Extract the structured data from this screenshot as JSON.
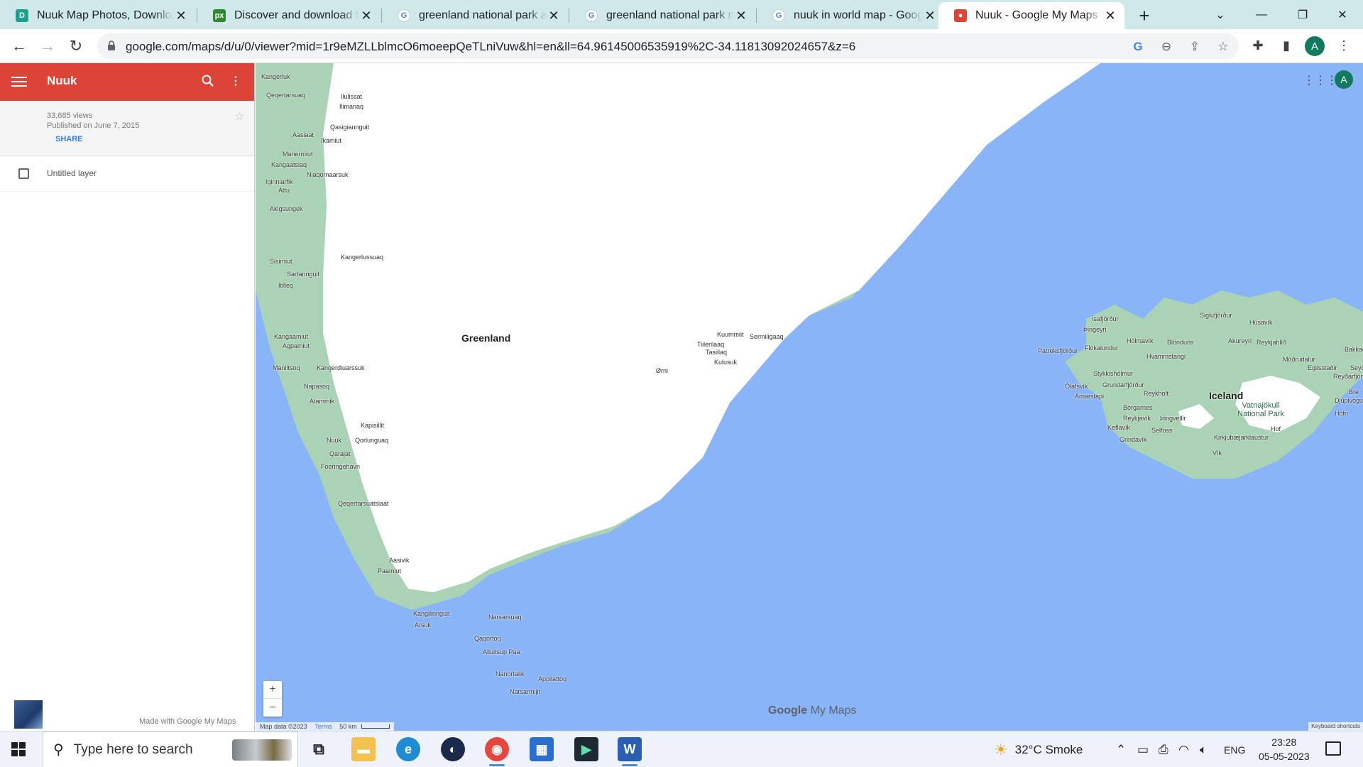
{
  "browser": {
    "tabs": [
      {
        "title": "Nuuk Map Photos, Download",
        "favicon": "D",
        "favicon_color": "#1ba28e",
        "active": false
      },
      {
        "title": "Discover and download free",
        "favicon": "PX",
        "favicon_color": "#2c8a2c",
        "active": false
      },
      {
        "title": "greenland national park and",
        "favicon": "G",
        "favicon_color": "#4285f4",
        "active": false
      },
      {
        "title": "greenland national park map",
        "favicon": "G",
        "favicon_color": "#4285f4",
        "active": false
      },
      {
        "title": "nuuk in world map - Google",
        "favicon": "G",
        "favicon_color": "#4285f4",
        "active": false
      },
      {
        "title": "Nuuk - Google My Maps",
        "favicon": "pin",
        "favicon_color": "#db4437",
        "active": true
      }
    ],
    "url": "google.com/maps/d/u/0/viewer?mid=1r9eMZLLblmcO6moeepQeTLniVuw&hl=en&ll=64.96145006535919%2C-34.11813092024657&z=6",
    "profile_initial": "A"
  },
  "sidebar": {
    "title": "Nuuk",
    "views": "33,685 views",
    "published": "Published on June 7, 2015",
    "share_label": "SHARE",
    "layer_label": "Untitled layer",
    "made_with": "Made with Google My Maps"
  },
  "map": {
    "labels": {
      "greenland": "Greenland",
      "iceland": "Iceland",
      "park": "Vatnajökull\nNational Park"
    },
    "greenland_towns": [
      "Kangerluk",
      "Qeqertarsuaq",
      "Ilulissat",
      "Ilimanaq",
      "Qasigiannguit",
      "Aasiaat",
      "Ikamiut",
      "Manermiut",
      "Kangaatsiaq",
      "Niaqornaarsuk",
      "Iginniarfik",
      "Attu",
      "Akigsungek",
      "Sisimiut",
      "Kangerlussuaq",
      "Sarfannguit",
      "Itilleq",
      "Kangaamiut",
      "Agpamiut",
      "Maniitsoq",
      "Kangerdluarssuk",
      "Napasoq",
      "Atammik",
      "Kapisillit",
      "Nuuk",
      "Qorlunguaq",
      "Qarajat",
      "Foeringehavn",
      "Qeqertarsuatsiaat",
      "Aasivik",
      "Paamiut",
      "Kangilinnguit",
      "Arsuk",
      "Narsarsuaq",
      "Qaqortoq",
      "Alluitsup Paa",
      "Nanortalik",
      "Narsarmijit",
      "Appilattoq",
      "Kuummiit",
      "Sermiligaaq",
      "Tiilerilaaq",
      "Tasiilaq",
      "Kulusuk",
      "Ørni"
    ],
    "iceland_towns": [
      "Ísafjörður",
      "Siglufjörður",
      "Húsavík",
      "Þingeyri",
      "Hólmavík",
      "Blönduós",
      "Akureyri",
      "Reykjahlíð",
      "Patreksfjörður",
      "Flókalundur",
      "Hvammstangi",
      "Möðrudalur",
      "Bakkag",
      "Egilsstaðir",
      "Seyð",
      "Reyðarfjörður",
      "Stykkishólmur",
      "Ólafsvík",
      "Grundarfjörður",
      "Arnarstapi",
      "Reykholt",
      "Borgarnes",
      "Reykjavík",
      "Þingvellir",
      "Keflavík",
      "Selfoss",
      "Grindavík",
      "Djúpivogur",
      "Höfn",
      "Hof",
      "Kirkjubæjarklaustur",
      "Vík",
      "Bre"
    ],
    "logo_google": "Google",
    "logo_mymaps": "My Maps",
    "attribution": "Map data ©2023",
    "terms": "Terms",
    "scale": "50 km",
    "keyboard": "Keyboard shortcuts",
    "zoom_in": "+",
    "zoom_out": "−"
  },
  "taskbar": {
    "search_placeholder": "Type here to search",
    "weather": "32°C  Smoke",
    "language": "ENG",
    "time": "23:28",
    "date": "05-05-2023"
  }
}
